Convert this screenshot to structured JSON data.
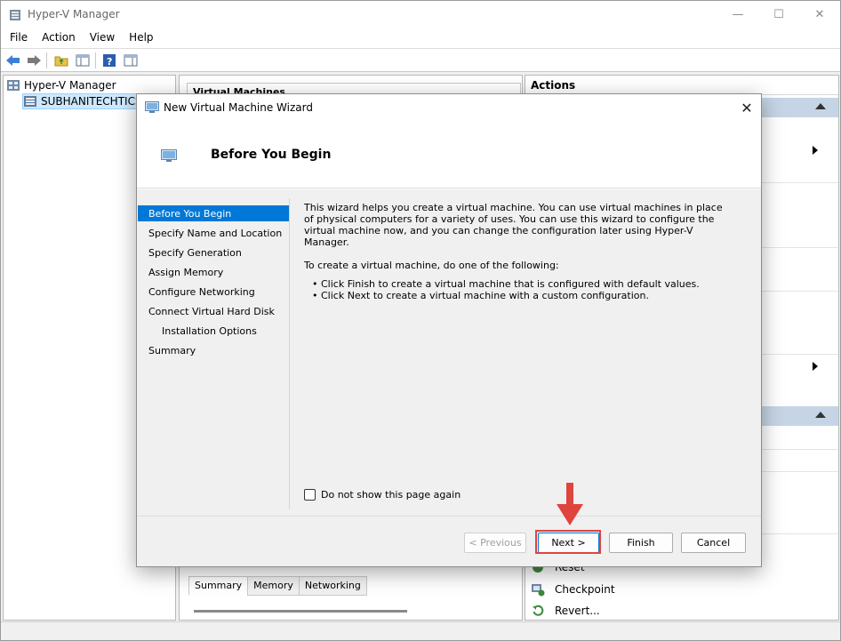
{
  "window": {
    "title": "Hyper-V Manager",
    "controls": {
      "minimize": "—",
      "maximize": "☐",
      "close": "✕"
    }
  },
  "menubar": [
    "File",
    "Action",
    "View",
    "Help"
  ],
  "tree": {
    "root": "Hyper-V Manager",
    "host": "SUBHANITECHTICS"
  },
  "center": {
    "header": "Virtual Machines",
    "tabs": [
      "Summary",
      "Memory",
      "Networking"
    ]
  },
  "actions": {
    "title": "Actions",
    "items": [
      {
        "label": "Reset",
        "icon": "reset-icon"
      },
      {
        "label": "Checkpoint",
        "icon": "checkpoint-icon"
      },
      {
        "label": "Revert...",
        "icon": "revert-icon"
      }
    ],
    "colors": {
      "section": "#c6d5e6"
    }
  },
  "dialog": {
    "title": "New Virtual Machine Wizard",
    "heading": "Before You Begin",
    "steps": [
      "Before You Begin",
      "Specify Name and Location",
      "Specify Generation",
      "Assign Memory",
      "Configure Networking",
      "Connect Virtual Hard Disk",
      "Installation Options",
      "Summary"
    ],
    "intro": "This wizard helps you create a virtual machine. You can use virtual machines in place of physical computers for a variety of uses. You can use this wizard to configure the virtual machine now, and you can change the configuration later using Hyper-V Manager.",
    "instruction": "To create a virtual machine, do one of the following:",
    "bullets": [
      "Click Finish to create a virtual machine that is configured with default values.",
      "Click Next to create a virtual machine with a custom configuration."
    ],
    "checkbox_label": "Do not show this page again",
    "buttons": {
      "previous": "< Previous",
      "next": "Next >",
      "finish": "Finish",
      "cancel": "Cancel"
    },
    "colors": {
      "active_step": "#0078d7",
      "highlight": "#e0443e"
    }
  }
}
